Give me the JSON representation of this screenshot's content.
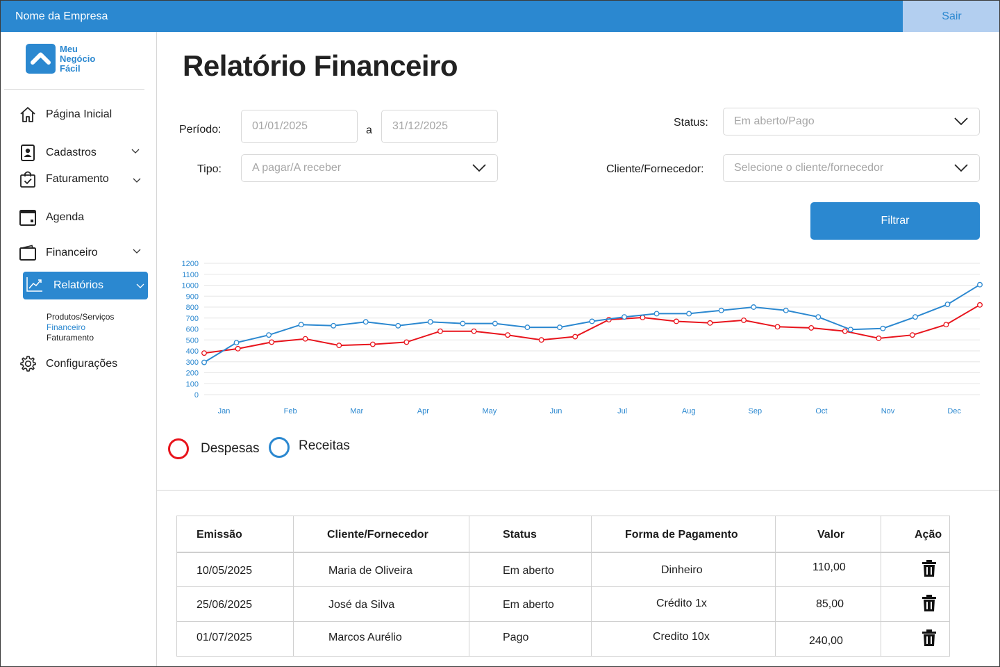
{
  "header": {
    "company": "Nome da Empresa",
    "logout_label": "Sair"
  },
  "logo": {
    "line1": "Meu",
    "line2": "Negócio",
    "line3": "Fácil"
  },
  "sidebar": {
    "items": [
      {
        "label": "Página Inicial",
        "icon": "home-icon"
      },
      {
        "label": "Cadastros",
        "icon": "id-card-icon"
      },
      {
        "label": "Faturamento",
        "icon": "shopping-bag-check-icon"
      },
      {
        "label": "Agenda",
        "icon": "calendar-icon"
      },
      {
        "label": "Financeiro",
        "icon": "wallet-icon"
      },
      {
        "label": "Relatórios",
        "icon": "trend-chart-icon"
      },
      {
        "label": "Configurações",
        "icon": "gear-icon"
      }
    ],
    "sub_items": [
      "Produtos/Serviços",
      "Financeiro",
      "Faturamento"
    ],
    "active_sub": "Financeiro"
  },
  "page": {
    "title": "Relatório Financeiro"
  },
  "filters": {
    "period_label": "Período:",
    "period_sep": "a",
    "period_start": "01/01/2025",
    "period_end": "31/12/2025",
    "type_label": "Tipo:",
    "type_placeholder": "A pagar/A receber",
    "status_label": "Status:",
    "status_placeholder": "Em aberto/Pago",
    "client_label": "Cliente/Fornecedor:",
    "client_placeholder": "Selecione o cliente/fornecedor",
    "filter_button": "Filtrar"
  },
  "chart_data": {
    "type": "line",
    "yticks": [
      0,
      100,
      200,
      300,
      400,
      500,
      600,
      700,
      800,
      900,
      1000,
      1100,
      1200
    ],
    "ylim": [
      0,
      1200
    ],
    "month_labels": [
      "Jan",
      "Feb",
      "Mar",
      "Apr",
      "May",
      "Jun",
      "Jul",
      "Aug",
      "Sep",
      "Oct",
      "Nov",
      "Dec"
    ],
    "series": [
      {
        "name": "Despesas",
        "color": "#e8141c",
        "values": [
          380,
          420,
          480,
          510,
          450,
          460,
          480,
          580,
          580,
          545,
          500,
          530,
          685,
          705,
          670,
          655,
          680,
          620,
          610,
          580,
          515,
          545,
          640,
          820
        ]
      },
      {
        "name": "Receitas",
        "color": "#2b88d0",
        "values": [
          295,
          475,
          545,
          640,
          630,
          665,
          630,
          665,
          650,
          650,
          615,
          615,
          670,
          710,
          740,
          740,
          770,
          800,
          770,
          710,
          595,
          605,
          710,
          825,
          1005
        ]
      }
    ],
    "grid": true
  },
  "legend": {
    "expenses": "Despesas",
    "income": "Receitas",
    "expenses_color": "#e8141c",
    "income_color": "#2b88d0"
  },
  "table": {
    "headers": [
      "Emissão",
      "Cliente/Fornecedor",
      "Status",
      "Forma de Pagamento",
      "Valor",
      "Ação"
    ],
    "rows": [
      {
        "date": "10/05/2025",
        "client": "Maria de Oliveira",
        "status": "Em aberto",
        "payment": "Dinheiro",
        "value": "110,00"
      },
      {
        "date": "25/06/2025",
        "client": "José da Silva",
        "status": "Em aberto",
        "payment": "Crédito 1x",
        "value": "85,00"
      },
      {
        "date": "01/07/2025",
        "client": "Marcos Aurélio",
        "status": "Pago",
        "payment": "Credito 10x",
        "value": "240,00"
      }
    ]
  }
}
